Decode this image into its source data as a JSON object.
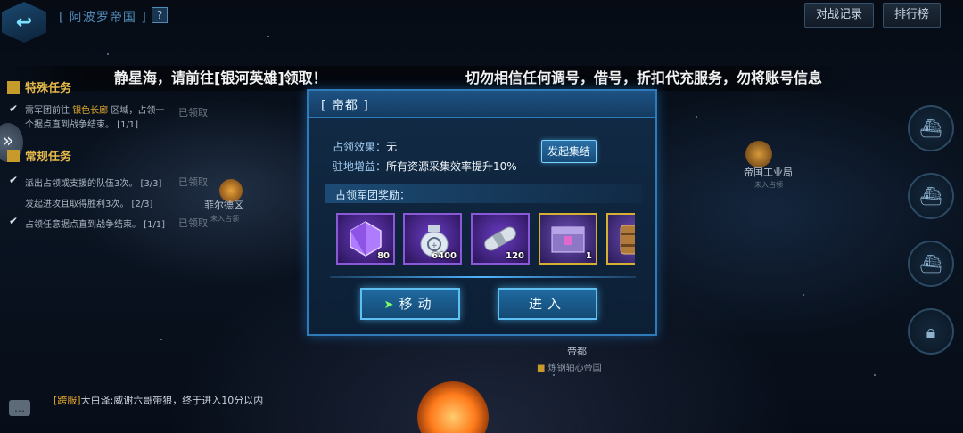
{
  "header": {
    "empire_title": "[ 阿波罗帝国 ]",
    "help_icon": "question-icon",
    "battle_record_label": "对战记录",
    "leaderboard_label": "排行榜"
  },
  "marquee": {
    "text_left": "静星海，请前往[银河英雄]领取！",
    "text_right": "切勿相信任何调号，借号，折扣代充服务，勿将账号信息"
  },
  "tasks": {
    "special_title": "特殊任务",
    "special_items": [
      {
        "line1_a": "需军团前往 ",
        "line1_hl": "银色长廊",
        "line1_b": " 区域，占领一",
        "line2": "个据点直到战争结束。 [1/1]",
        "status": "已领取"
      }
    ],
    "regular_title": "常规任务",
    "regular_items": [
      {
        "text": "派出占领或支援的队伍3次。 [3/3]",
        "status": "已领取",
        "checked": true
      },
      {
        "text": "发起进攻且取得胜利3次。 [2/3]",
        "status": "",
        "checked": false
      },
      {
        "text": "占领任意据点直到战争结束。 [1/1]",
        "status": "已领取",
        "checked": true
      }
    ]
  },
  "map": {
    "location_1": "菲尔德区",
    "location_1_sub": "未入占领",
    "location_2": "帝国工业局",
    "location_2_sub": "未入占领",
    "location_3": "帝都",
    "location_3_sub": "炼钢轴心帝国"
  },
  "chat": {
    "channel": "[跨服]",
    "message": "大白泽:威谢六哥带狼，终于进入10分以内"
  },
  "modal": {
    "title": "[ 帝都 ]",
    "occupy_effect_label": "占领效果：",
    "occupy_effect_value": "无",
    "garrison_bonus_label": "驻地增益：",
    "garrison_bonus_value": "所有资源采集效率提升10%",
    "rally_button": "发起集结",
    "reward_section_label": "占领军团奖励：",
    "rewards": [
      {
        "icon": "purple-gem-icon",
        "qty": "80"
      },
      {
        "icon": "money-bag-icon",
        "qty": "6400"
      },
      {
        "icon": "silver-capsule-icon",
        "qty": "120"
      },
      {
        "icon": "supply-crate-icon",
        "qty": "1"
      },
      {
        "icon": "bronze-barrel-icon",
        "qty": ""
      }
    ],
    "move_button": "移动",
    "enter_button": "进入"
  },
  "colors": {
    "modal_border": "#2f7ab8",
    "button_glow": "#5ec0f2",
    "task_gold": "#e5b84a",
    "highlight": "#e2a82e"
  }
}
